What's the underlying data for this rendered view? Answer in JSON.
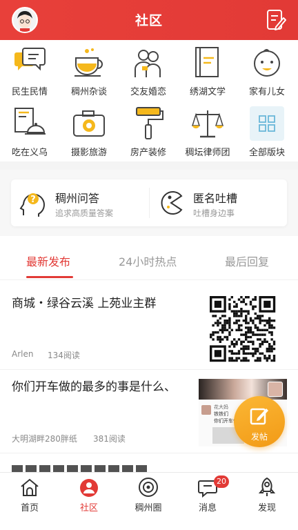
{
  "header": {
    "title": "社区"
  },
  "categories": [
    {
      "label": "民生民情",
      "icon": "chat-bubbles-icon"
    },
    {
      "label": "稠州杂谈",
      "icon": "teacup-icon"
    },
    {
      "label": "交友婚恋",
      "icon": "couple-icon"
    },
    {
      "label": "绣湖文学",
      "icon": "book-icon"
    },
    {
      "label": "家有儿女",
      "icon": "baby-icon"
    },
    {
      "label": "吃在义乌",
      "icon": "food-menu-icon"
    },
    {
      "label": "摄影旅游",
      "icon": "camera-icon"
    },
    {
      "label": "房产装修",
      "icon": "paint-roller-icon"
    },
    {
      "label": "稠坛律师团",
      "icon": "scales-icon"
    },
    {
      "label": "全部版块",
      "icon": "grid-icon"
    }
  ],
  "qa": [
    {
      "title": "稠州问答",
      "subtitle": "追求高质量答案",
      "icon": "question-head-icon"
    },
    {
      "title": "匿名吐槽",
      "subtitle": "吐槽身边事",
      "icon": "pacman-icon"
    }
  ],
  "tabs": [
    {
      "label": "最新发布",
      "active": true
    },
    {
      "label": "24小时热点",
      "active": false
    },
    {
      "label": "最后回复",
      "active": false
    }
  ],
  "posts": [
    {
      "title": "商城・绿谷云溪 上苑业主群",
      "author": "Arlen",
      "reads": "134阅读",
      "thumb": "qr-code"
    },
    {
      "title": "你们开车做的最多的事是什么、",
      "author": "大明湖畔280胖纸",
      "reads": "381阅读",
      "thumb": "chat-screenshot"
    }
  ],
  "thumb_chat": {
    "name": "花大妈",
    "line1": "铁铁们",
    "line2": "你们开车做话"
  },
  "fab": {
    "label": "发帖"
  },
  "bottom_nav": [
    {
      "label": "首页",
      "icon": "home-icon",
      "active": false
    },
    {
      "label": "社区",
      "icon": "community-icon",
      "active": true
    },
    {
      "label": "稠州圈",
      "icon": "circle-icon",
      "active": false
    },
    {
      "label": "消息",
      "icon": "message-icon",
      "active": false,
      "badge": "20"
    },
    {
      "label": "发现",
      "icon": "rocket-icon",
      "active": false
    }
  ],
  "colors": {
    "primary": "#e23a36",
    "accent": "#f5b81c",
    "fab": "#f6a623"
  }
}
